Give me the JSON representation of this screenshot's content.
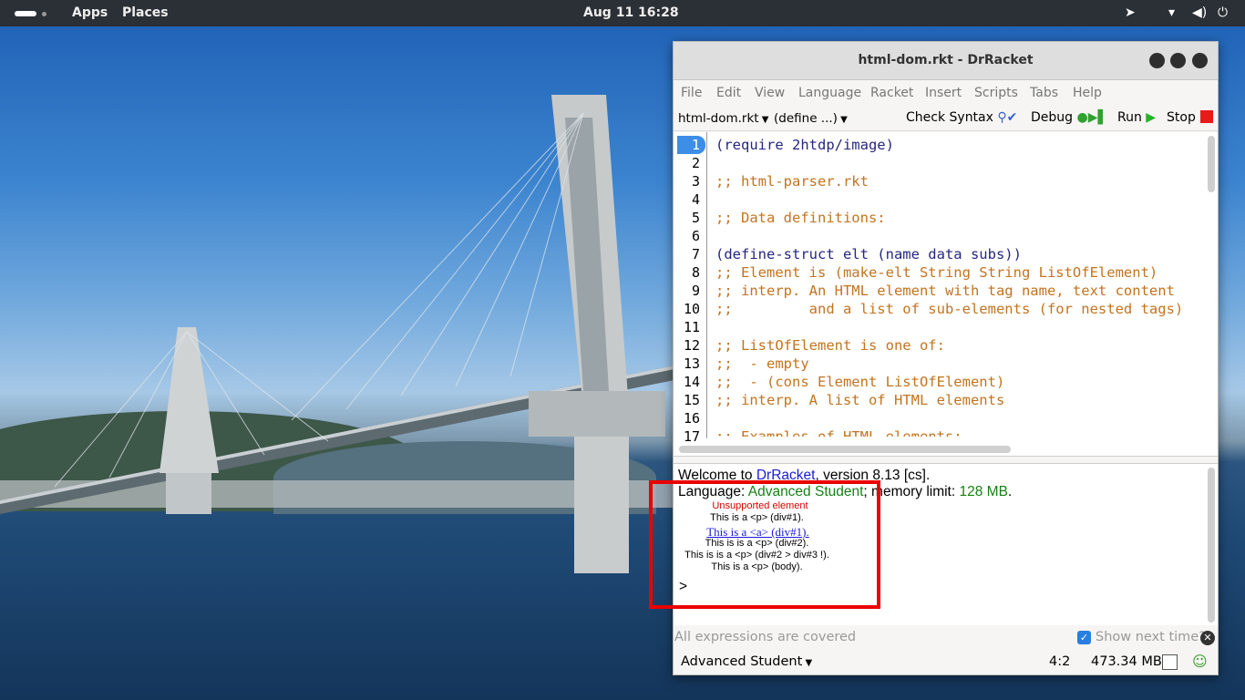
{
  "topbar": {
    "apps": "Apps",
    "places": "Places",
    "clock": "Aug 11  16:28"
  },
  "window": {
    "title": "html-dom.rkt - DrRacket",
    "menu": [
      "File",
      "Edit",
      "View",
      "Language",
      "Racket",
      "Insert",
      "Scripts",
      "Tabs",
      "Help"
    ],
    "toolbar": {
      "file_dropdown": "html-dom.rkt",
      "define_dropdown": "(define ...)",
      "check_syntax": "Check Syntax",
      "debug": "Debug",
      "run": "Run",
      "stop": "Stop"
    },
    "editor": {
      "current_line": "1",
      "lines": [
        "(require 2htdp/image)",
        "",
        ";; html-parser.rkt",
        "",
        ";; Data definitions:",
        "",
        "(define-struct elt (name data subs))",
        ";; Element is (make-elt String String ListOfElement)",
        ";; interp. An HTML element with tag name, text content",
        ";;         and a list of sub-elements (for nested tags)",
        "",
        ";; ListOfElement is one of:",
        ";;  - empty",
        ";;  - (cons Element ListOfElement)",
        ";; interp. A list of HTML elements",
        "",
        ";; Examples of HTML elements:"
      ]
    },
    "repl": {
      "welcome_prefix": "Welcome to ",
      "drracket_link": "DrRacket",
      "version_suffix": ", version 8.13 [cs].",
      "language_prefix": "Language: ",
      "language_name": "Advanced Student",
      "memory_prefix": "; memory limit: ",
      "memory_limit": "128 MB",
      "memory_suffix": ".",
      "output": {
        "unsupported": "Unsupported element",
        "p_div1": "This is a <p> (div#1).",
        "a_div1": "This is a <a> (div#1).",
        "p_div2": "This is is a <p> (div#2).",
        "p_div2_div3": "This is is a <p> (div#2 > div#3 !).",
        "p_body": "This is a <p> (body)."
      },
      "prompt": ">"
    },
    "status": {
      "message": "All expressions are covered",
      "show_next": "Show next time?"
    },
    "bottom": {
      "language": "Advanced Student",
      "position": "4:2",
      "memory": "473.34 MB"
    }
  },
  "colors": {
    "highlight": "#ea0000",
    "keyword": "#262680",
    "comment": "#c2741f",
    "link": "#1a1ad8",
    "green_text": "#178017"
  }
}
